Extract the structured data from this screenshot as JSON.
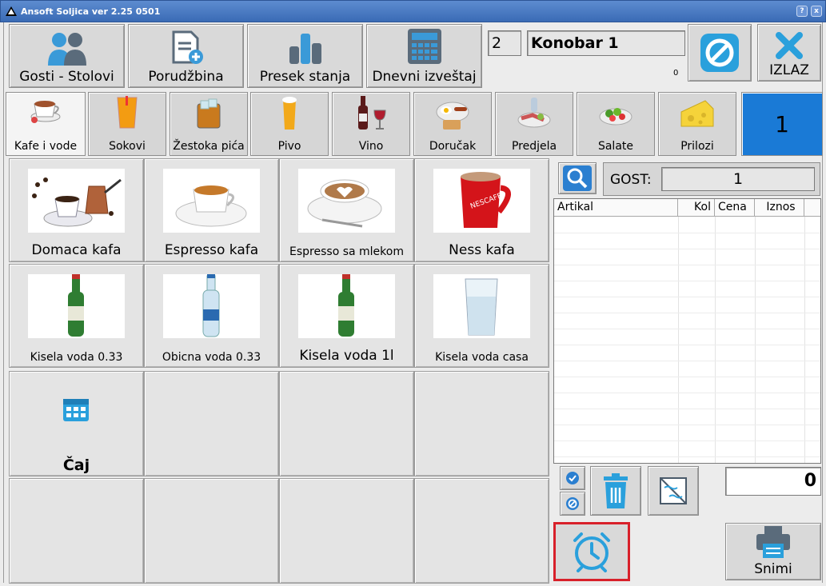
{
  "window": {
    "title": "Ansoft Soljica ver 2.25 0501",
    "help": "?",
    "close": "x"
  },
  "toolbar": {
    "guests_tables": "Gosti - Stolovi",
    "order": "Porudžbina",
    "status": "Presek stanja",
    "daily_report": "Dnevni izveštaj",
    "exit": "IZLAZ"
  },
  "header": {
    "table_number": "2",
    "waiter": "Konobar 1",
    "counter": "0"
  },
  "categories": [
    {
      "label": "Kafe i vode",
      "icon": "coffee-cup-icon"
    },
    {
      "label": "Sokovi",
      "icon": "juice-glass-icon"
    },
    {
      "label": "Žestoka pića",
      "icon": "whiskey-glass-icon"
    },
    {
      "label": "Pivo",
      "icon": "beer-glass-icon"
    },
    {
      "label": "Vino",
      "icon": "wine-bottle-icon"
    },
    {
      "label": "Doručak",
      "icon": "breakfast-plate-icon"
    },
    {
      "label": "Predjela",
      "icon": "appetizer-plate-icon"
    },
    {
      "label": "Salate",
      "icon": "salad-plate-icon"
    },
    {
      "label": "Prilozi",
      "icon": "cheese-icon"
    }
  ],
  "page_indicator": "1",
  "products": [
    {
      "name": "Domaca kafa",
      "icon": "turkish-coffee-icon"
    },
    {
      "name": "Espresso kafa",
      "icon": "espresso-cup-icon"
    },
    {
      "name": "Espresso sa mlekom",
      "icon": "cappuccino-cup-icon"
    },
    {
      "name": "Ness kafa",
      "icon": "nescafe-mug-icon"
    },
    {
      "name": "Kisela voda 0.33",
      "icon": "green-bottle-icon"
    },
    {
      "name": "Obicna voda 0.33",
      "icon": "water-bottle-icon"
    },
    {
      "name": "Kisela voda 1l",
      "icon": "green-bottle-icon"
    },
    {
      "name": "Kisela voda casa",
      "icon": "water-glass-icon"
    },
    {
      "name": "Čaj",
      "icon": "calendar-icon"
    }
  ],
  "guest": {
    "label": "GOST:",
    "value": "1"
  },
  "order_table": {
    "columns": [
      "Artikal",
      "Kol",
      "Cena",
      "Iznos"
    ],
    "rows": []
  },
  "total": "0",
  "actions": {
    "print_label": "Snimi"
  }
}
